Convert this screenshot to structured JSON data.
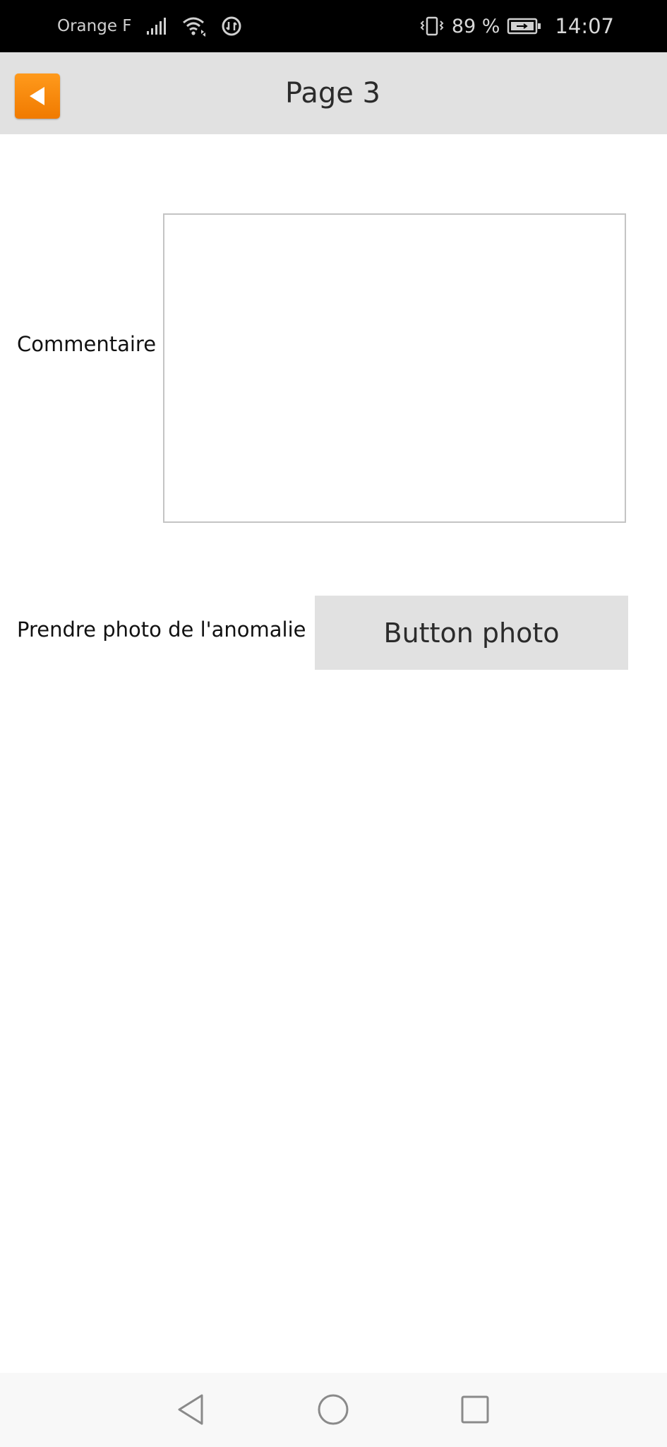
{
  "status_bar": {
    "carrier": "Orange F",
    "battery": "89 %",
    "time": "14:07",
    "icons": [
      "signal-icon",
      "wifi-icon",
      "data-saver-icon",
      "vibrate-icon",
      "battery-icon"
    ]
  },
  "header": {
    "title": "Page 3",
    "back_icon": "back-arrow-icon"
  },
  "form": {
    "comment_label": "Commentaire",
    "comment_value": "",
    "photo_label": "Prendre photo de l'anomalie",
    "photo_button_label": "Button photo"
  },
  "nav_bar": {
    "icons": [
      "nav-back-icon",
      "nav-home-icon",
      "nav-recents-icon"
    ]
  },
  "colors": {
    "accent": "#f58600",
    "header_bg": "#e1e1e1",
    "status_bg": "#000000",
    "button_bg": "#e1e1e1"
  }
}
